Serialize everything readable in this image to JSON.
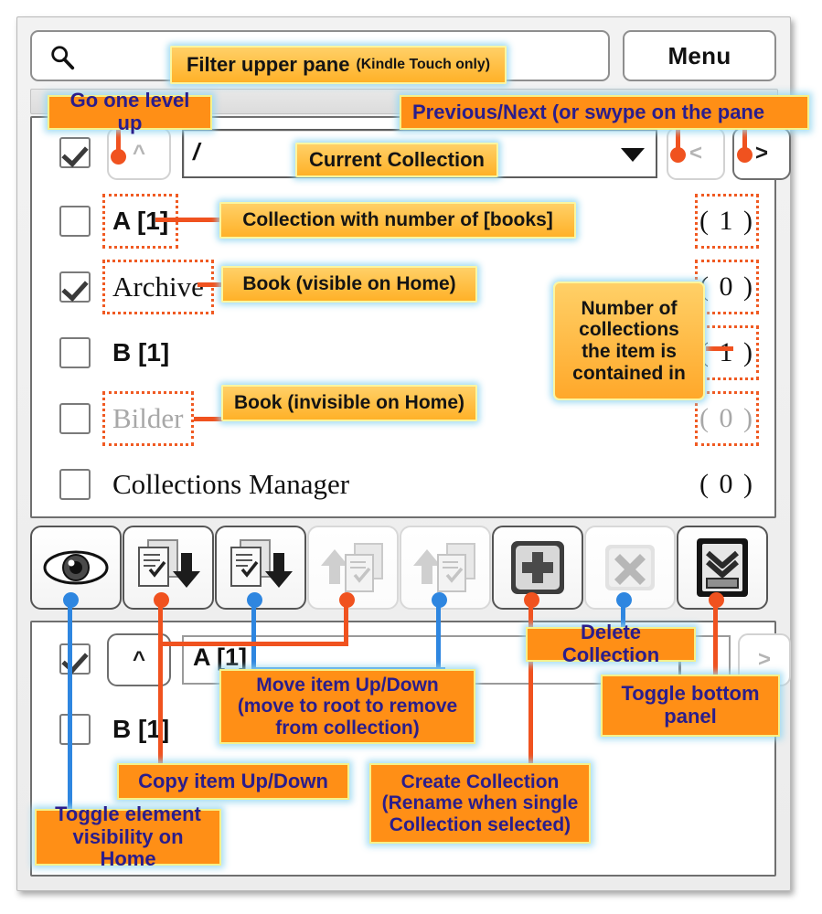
{
  "search": {
    "icon": "search-icon",
    "menu_label": "Menu"
  },
  "nav": {
    "up_label": "^",
    "path_value": "/",
    "prev_label": "<",
    "next_label": ">"
  },
  "upper_rows": [
    {
      "label": "A [1]",
      "count": "( 1 )",
      "checked": false,
      "style": "bold",
      "dim": false,
      "dotted_label": true,
      "dotted_count": true
    },
    {
      "label": "Archive",
      "count": "( 0 )",
      "checked": true,
      "style": "serif",
      "dim": false,
      "dotted_label": true,
      "dotted_count": true
    },
    {
      "label": "B [1]",
      "count": "( 1 )",
      "checked": false,
      "style": "bold",
      "dim": false,
      "dotted_label": false,
      "dotted_count": true
    },
    {
      "label": "Bilder",
      "count": "( 0 )",
      "checked": false,
      "style": "serif",
      "dim": true,
      "dotted_label": true,
      "dotted_count": true
    },
    {
      "label": "Collections Manager",
      "count": "( 0 )",
      "checked": false,
      "style": "serif",
      "dim": false,
      "dotted_label": false,
      "dotted_count": false
    }
  ],
  "toolbar": [
    {
      "name": "toggle-visibility-button",
      "icon": "eye-icon",
      "enabled": true
    },
    {
      "name": "move-item-down-button",
      "icon": "doc-down-arrow-icon",
      "enabled": true
    },
    {
      "name": "copy-item-down-button",
      "icon": "doc-down-arrow-icon",
      "enabled": true
    },
    {
      "name": "move-item-up-button",
      "icon": "doc-up-arrow-icon",
      "enabled": false
    },
    {
      "name": "copy-item-up-button",
      "icon": "doc-up-arrow-icon",
      "enabled": false
    },
    {
      "name": "create-collection-button",
      "icon": "plus-icon",
      "enabled": true
    },
    {
      "name": "delete-collection-button",
      "icon": "x-icon",
      "enabled": false
    },
    {
      "name": "toggle-bottom-panel-button",
      "icon": "panel-collapse-icon",
      "enabled": true
    }
  ],
  "lower": {
    "up_label": "^",
    "path_value": "A [1]",
    "next_label": ">",
    "row_label": "B [1]"
  },
  "callouts": {
    "filter_main": "Filter upper pane",
    "filter_sub": "(Kindle Touch only)",
    "go_up": "Go one level up",
    "prev_next": "Previous/Next (or swype on the pane",
    "current_collection": "Current Collection",
    "collection_with_books": "Collection with number of [books]",
    "book_visible": "Book (visible on Home)",
    "book_invisible": "Book (invisible on Home)",
    "num_collections": "Number of collections the item is contained in",
    "delete_collection": "Delete Collection",
    "toggle_bottom_panel": "Toggle bottom panel",
    "move_item": "Move item Up/Down (move to root to remove from collection)",
    "copy_item": "Copy item Up/Down",
    "create_collection": "Create Collection (Rename when single Collection selected)",
    "toggle_visibility": "Toggle element visibility on Home"
  },
  "colors": {
    "callout_fill": "#ff8f16",
    "callout_text": "#2a1d8c",
    "connector_orange": "#f0521f",
    "connector_blue": "#2e86e0",
    "dotted_outline": "#f05a22"
  }
}
